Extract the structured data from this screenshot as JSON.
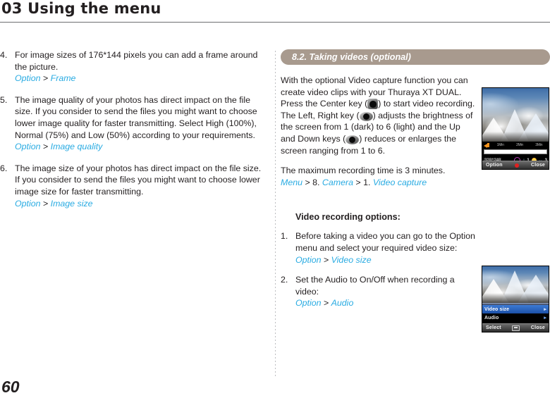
{
  "header": {
    "chapter_title": "03 Using the menu"
  },
  "page_number": "60",
  "left_column": {
    "items": [
      {
        "num": "4.",
        "text": "For image sizes of 176*144 pixels you can add a frame around the picture.",
        "path_first": "Option",
        "path_sep": " > ",
        "path_second": "Frame"
      },
      {
        "num": "5.",
        "text": "The image quality of your photos has direct impact on the file size. If you consider to send the files you might want to choose lower image quality for faster transmitting. Select High (100%), Normal (75%) and Low (50%) according to your requirements.",
        "path_first": "Option",
        "path_sep": " > ",
        "path_second": "Image quality"
      },
      {
        "num": "6.",
        "text": "The image size of your photos has direct impact on the file size. If you consider to send the files you might want to choose lower image size for faster transmitting.",
        "path_first": "Option",
        "path_sep": " > ",
        "path_second": "Image size"
      }
    ]
  },
  "right_column": {
    "section_title": "8.2. Taking videos (optional)",
    "intro": {
      "p1": "With the optional Video capture function you can create video clips with your Thuraya XT DUAL. Press the Center key (",
      "p2": ") to start video recording. The Left, Right key (",
      "p3": ") adjusts the brightness of the screen from 1 (dark) to 6 (light) and the Up and Down keys (",
      "p4": ") reduces or enlarges the screen ranging from 1 to 6."
    },
    "max_time": {
      "sentence": "The maximum recording time is 3 minutes.",
      "path_menu": "Menu",
      "sep1": " > ",
      "num8": "8. ",
      "path_camera": "Camera",
      "sep2": " > ",
      "num1": "1. ",
      "path_capture": "Video capture"
    },
    "subhead": "Video recording options:",
    "options": [
      {
        "num": "1.",
        "text": "Before taking a video you can go to the Option menu and select your required video size:",
        "path_first": "Option",
        "path_sep": " > ",
        "path_second": "Video size"
      },
      {
        "num": "2.",
        "text": "Set the Audio to On/Off when recording a video:",
        "path_first": "Option",
        "path_sep": " > ",
        "path_second": "Audio"
      }
    ]
  },
  "screenshots": {
    "video_recording": {
      "time_labels": [
        "1Min",
        "2Min",
        "3Min"
      ],
      "resolution": "320*240",
      "zoom_level": "1",
      "brightness_level": "3",
      "softkey_left": "Option",
      "softkey_right": "Close"
    },
    "option_menu": {
      "items": [
        "Video  size",
        "Audio"
      ],
      "selected_index": 0,
      "chevron": "▸",
      "softkey_left": "Select",
      "softkey_right": "Close"
    }
  },
  "colors": {
    "link": "#29abe2",
    "section_bar": "#a89a8e",
    "text": "#231f20",
    "rule": "#6d6e71"
  }
}
